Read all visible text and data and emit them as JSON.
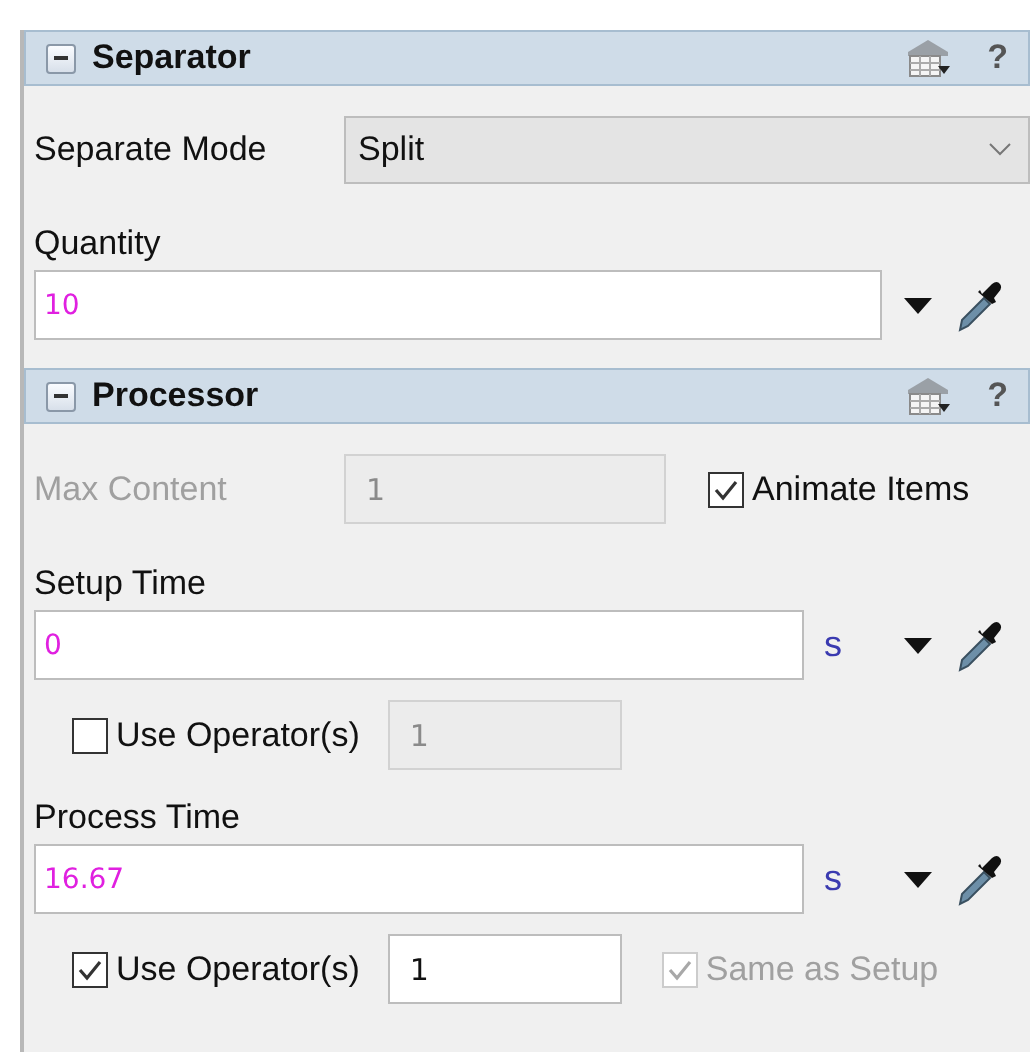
{
  "sections": [
    {
      "title": "Separator",
      "expanded": true,
      "help": "?",
      "rows": [
        {
          "kind": "select",
          "label": "Separate Mode",
          "value": "Split"
        },
        {
          "kind": "code",
          "label": "Quantity",
          "value": "10"
        }
      ]
    },
    {
      "title": "Processor",
      "expanded": true,
      "help": "?",
      "rows": [
        {
          "kind": "content",
          "label": "Max Content",
          "value": "1",
          "disabled": true,
          "check": {
            "label": "Animate Items",
            "checked": true
          }
        },
        {
          "kind": "code",
          "label": "Setup Time",
          "value": "0",
          "unit": "s"
        },
        {
          "kind": "operators",
          "check": {
            "label": "Use Operator(s)",
            "checked": false
          },
          "value": "1",
          "disabled": true
        },
        {
          "kind": "code",
          "label": "Process Time",
          "value": "16.67",
          "unit": "s"
        },
        {
          "kind": "operators",
          "check": {
            "label": "Use Operator(s)",
            "checked": true
          },
          "value": "1",
          "disabled": false,
          "extra": {
            "label": "Same as Setup",
            "checked": true,
            "disabled": true
          }
        }
      ]
    }
  ]
}
